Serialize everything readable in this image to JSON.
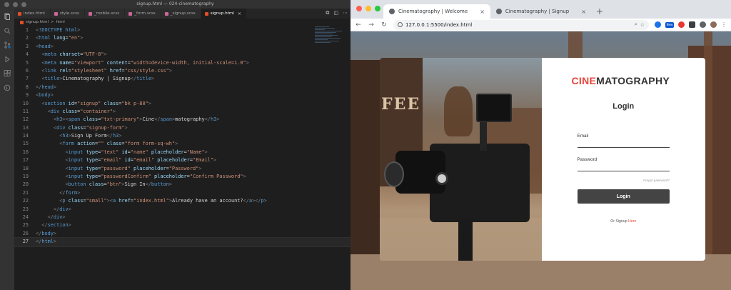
{
  "editor": {
    "window_title": "signup.html — 024-cinematography",
    "tabs": [
      {
        "label": "index.html",
        "kind": "html"
      },
      {
        "label": "style.scss",
        "kind": "scss"
      },
      {
        "label": "_mobile.scss",
        "kind": "scss"
      },
      {
        "label": "_form.scss",
        "kind": "scss"
      },
      {
        "label": "_signup.scss",
        "kind": "scss"
      },
      {
        "label": "signup.html",
        "kind": "html",
        "active": true
      }
    ],
    "breadcrumb": [
      "signup.html",
      ">",
      "html"
    ],
    "line_numbers": [
      "1",
      "2",
      "3",
      "4",
      "5",
      "6",
      "7",
      "8",
      "9",
      "10",
      "11",
      "12",
      "13",
      "14",
      "15",
      "16",
      "17",
      "18",
      "19",
      "20",
      "21",
      "22",
      "23",
      "24",
      "25",
      "26",
      "27"
    ],
    "code_lines": [
      "<!DOCTYPE html>",
      "<html lang=\"en\">",
      "<head>",
      "  <meta charset=\"UTF-8\">",
      "  <meta name=\"viewport\" content=\"width=device-width, initial-scale=1.0\">",
      "  <link rel=\"stylesheet\" href=\"css/style.css\">",
      "  <title>Cinematography | Signup</title>",
      "</head>",
      "<body>",
      "  <section id=\"signup\" class=\"bk p-80\">",
      "    <div class=\"container\">",
      "      <h3><span class=\"txt-primary\">Cine</span>matography</h3>",
      "      <div class=\"signup-form\">",
      "        <h3>Sign Up Form</h3>",
      "        <form action=\"\" class=\"form form-sq-wh\">",
      "          <input type=\"text\" id=\"name\" placeholder=\"Name\">",
      "          <input type=\"email\" id=\"email\" placeholder=\"Email\">",
      "          <input type=\"password\" placeholder=\"Password\">",
      "          <input type=\"passwordConfirm\" placeholder=\"Confirm Password\">",
      "          <button class=\"btn\">Sign In</button>",
      "        </form>",
      "        <p class=\"small\"><a href=\"index.html\">Already have an account?</a></p>",
      "      </div>",
      "    </div>",
      "  </section>",
      "</body>",
      "</html>"
    ],
    "current_line": 27
  },
  "browser": {
    "tabs": [
      {
        "label": "Cinematography | Welcome",
        "active": true
      },
      {
        "label": "Cinematography | Signup",
        "active": false
      }
    ],
    "new_tab_label": "+",
    "url": "127.0.0.1:5500/index.html",
    "extension_badge": "New"
  },
  "page": {
    "brand_accent": "CINE",
    "brand_rest": "MATOGRAPHY",
    "photo_sign": "FEE",
    "login_title": "Login",
    "email_label": "Email",
    "password_label": "Password",
    "forgot_link": "Forgot password?",
    "login_button": "Login",
    "signup_prefix": "Or Signup ",
    "signup_link": "Here"
  },
  "colors": {
    "accent": "#e8453c",
    "button": "#444444",
    "editor_bg": "#1e1e1e"
  }
}
